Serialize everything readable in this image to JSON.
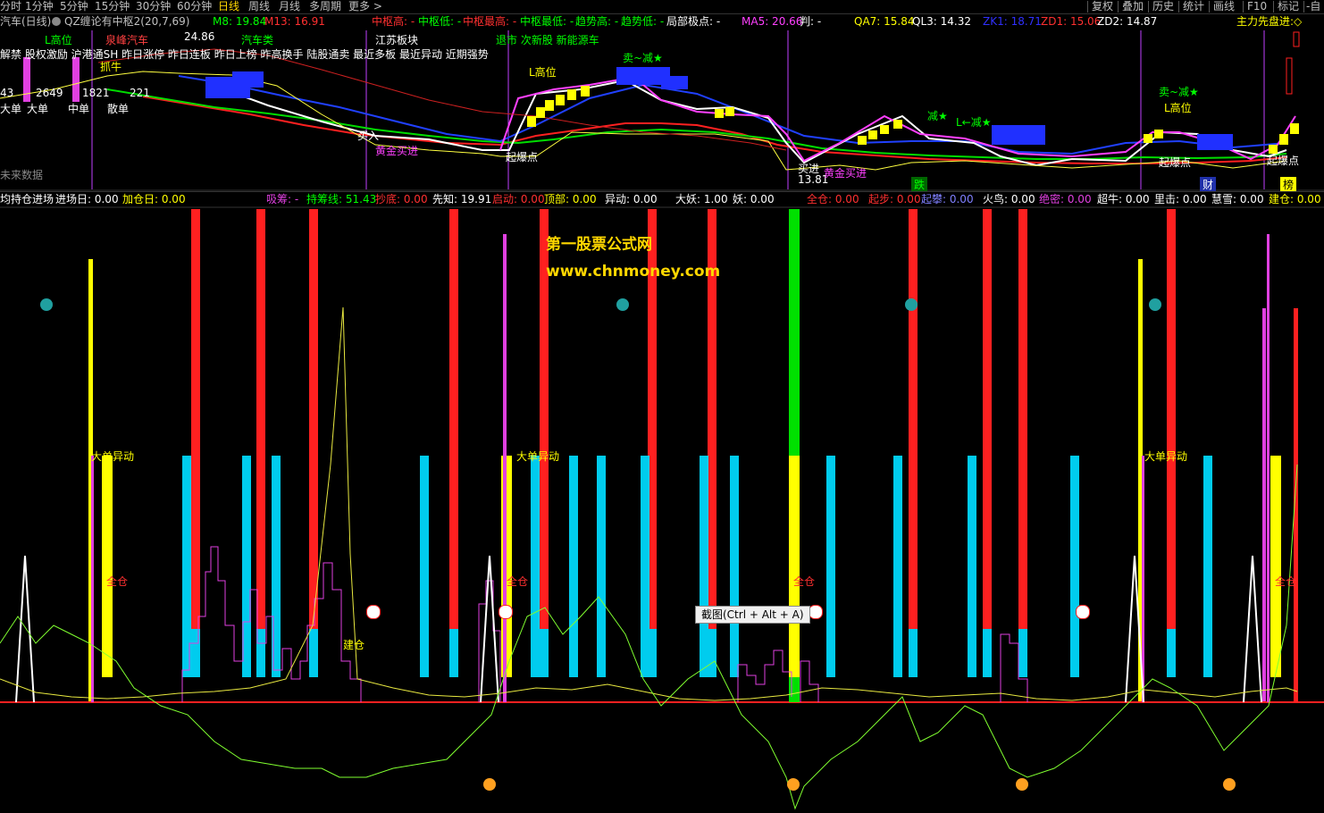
{
  "topbar": {
    "items": [
      "分时",
      "1分钟",
      "5分钟",
      "15分钟",
      "30分钟",
      "60分钟",
      "日线",
      "周线",
      "月线",
      "多周期",
      "更多 >"
    ],
    "right": [
      "复权",
      "叠加",
      "历史",
      "统计",
      "画线",
      "F10",
      "标记",
      "-自"
    ]
  },
  "info": {
    "title": "汽车(日线)",
    "formula": "QZ缠论有中枢2(20,7,69)",
    "m8": "M8: 19.84",
    "m13": "M13: 16.91",
    "zs_high": "中枢高: -",
    "zs_low": "中枢低: -",
    "zs_max": "中枢最高: -",
    "zs_min": "中枢最低: -",
    "trend_high": "趋势高: -",
    "trend_low": "趋势低: -",
    "local_pt": "局部极点: -",
    "ma5": "MA5: 20.66",
    "judge": "判: -",
    "qa7": "QA7: 15.84",
    "ql3": "QL3: 14.32",
    "zk1": "ZK1: 18.71",
    "zd1": "ZD1: 15.06",
    "zd2": "ZD2: 14.87",
    "main_force": "主力先盘进:◇"
  },
  "chart_labels": {
    "high1": "L高位",
    "sector1": "泉峰汽车",
    "price1": "24.86",
    "sector2": "汽车类",
    "sector3": "江苏板块",
    "tags": "退市 次新股 新能源车",
    "line3": "解禁 股权激励 沪港通SH 昨日涨停 昨日连板 昨日上榜 昨高换手 陆股通卖 最近多板 最近异动 近期强势",
    "v1": "2649",
    "v2": "1821",
    "v3": "221",
    "v0": "43",
    "big_single": "大单",
    "big": "大单",
    "mid": "中单",
    "small": "散单",
    "no_data": "未来数据",
    "catch": "抓牛",
    "high2": "L高位",
    "reduce1": "卖~减★",
    "buy1": "买入",
    "gold_buy": "黄金买进",
    "take_off": "起爆点",
    "take_off2": "起爆点",
    "take_off3": "起爆点",
    "buy2": "买进",
    "price2": "13.81",
    "gold_buy2": "黄金买进",
    "reduce2": "减★",
    "reduce3": "L←减★",
    "reduce4": "卖~减★",
    "high3": "L高位",
    "die": "跌",
    "cai": "财",
    "bang": "榜"
  },
  "ind2": {
    "name": "均持仓进场",
    "enter_day": "进场日: 0.00",
    "add_day": "加仓日: 0.00",
    "xichou": "吸筹: -",
    "chichou": "持筹线: 51.43",
    "chaodi": "抄底: 0.00",
    "xianzhi": "先知: 19.91",
    "qidong": "启动: 0.00",
    "dingbu": "顶部: 0.00",
    "yidong": "异动: 0.00",
    "dayao": "大妖: 1.00",
    "yao": "妖: 0.00",
    "quancang": "全仓: 0.00",
    "qibu": "起步: 0.00",
    "qipan": "起攀: 0.00",
    "huoniao": "火鸟: 0.00",
    "juemi": "绝密: 0.00",
    "chaoniu": "超牛: 0.00",
    "lichui": "里击: 0.00",
    "huixue": "慧雪: 0.00",
    "jiancang": "建仓: 0.00"
  },
  "watermark": {
    "line1": "第一股票公式网",
    "line2": "www.chnmoney.com"
  },
  "annotations": {
    "big_move": "大单异动",
    "full": "全仓",
    "build": "建仓"
  },
  "tooltip": "截图(Ctrl + Alt + A)",
  "colors": {
    "red": "#ff2020",
    "cyan": "#00ccee",
    "yellow": "#ffff00",
    "green": "#00e000",
    "magenta": "#e040e0"
  }
}
